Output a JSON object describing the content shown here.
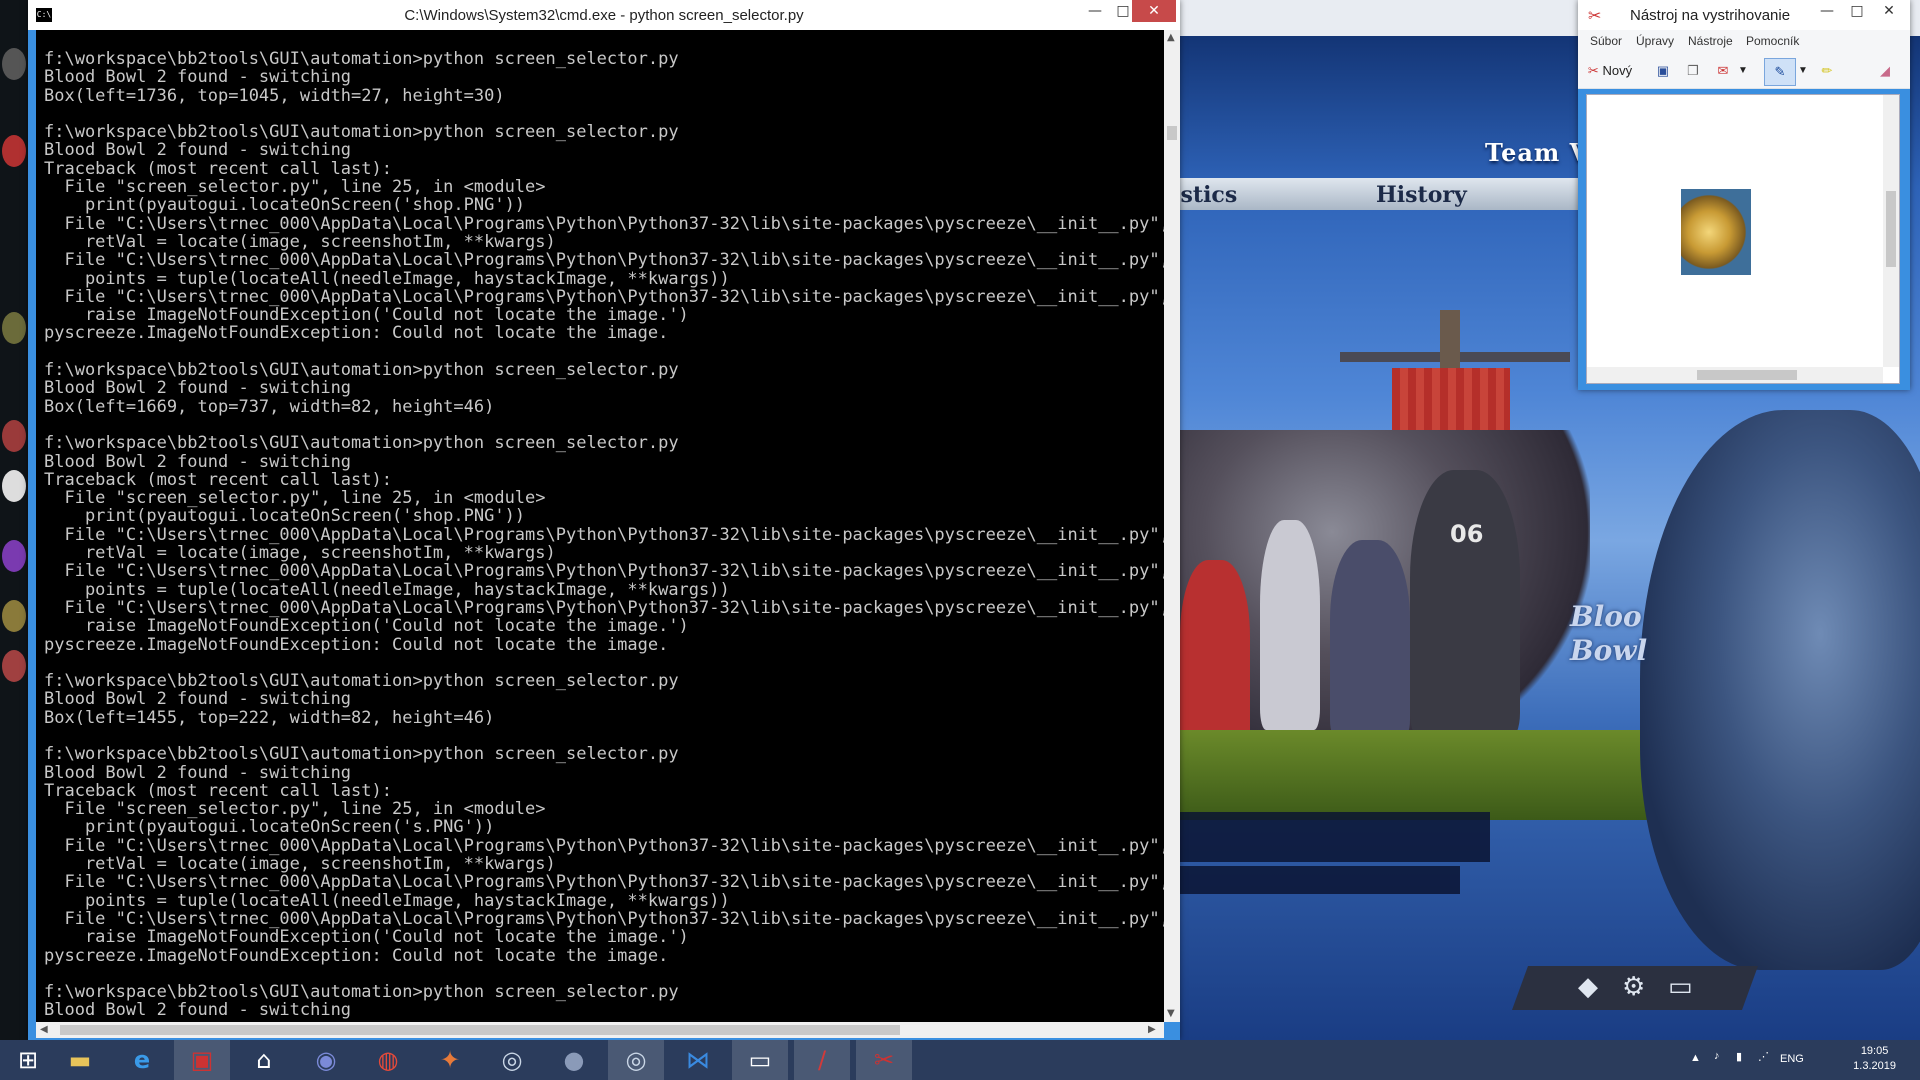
{
  "cmd_window": {
    "title": "C:\\Windows\\System32\\cmd.exe - python  screen_selector.py",
    "icon_text": "C:\\",
    "minimize": "—",
    "maximize": "□",
    "close": "✕",
    "console_lines": [
      "f:\\workspace\\bb2tools\\GUI\\automation>python screen_selector.py",
      "Blood Bowl 2 found - switching",
      "Box(left=1736, top=1045, width=27, height=30)",
      "",
      "f:\\workspace\\bb2tools\\GUI\\automation>python screen_selector.py",
      "Blood Bowl 2 found - switching",
      "Traceback (most recent call last):",
      "  File \"screen_selector.py\", line 25, in <module>",
      "    print(pyautogui.locateOnScreen('shop.PNG'))",
      "  File \"C:\\Users\\trnec_000\\AppData\\Local\\Programs\\Python\\Python37-32\\lib\\site-packages\\pyscreeze\\__init__.py\", l",
      "    retVal = locate(image, screenshotIm, **kwargs)",
      "  File \"C:\\Users\\trnec_000\\AppData\\Local\\Programs\\Python\\Python37-32\\lib\\site-packages\\pyscreeze\\__init__.py\", l",
      "    points = tuple(locateAll(needleImage, haystackImage, **kwargs))",
      "  File \"C:\\Users\\trnec_000\\AppData\\Local\\Programs\\Python\\Python37-32\\lib\\site-packages\\pyscreeze\\__init__.py\", l",
      "    raise ImageNotFoundException('Could not locate the image.')",
      "pyscreeze.ImageNotFoundException: Could not locate the image.",
      "",
      "f:\\workspace\\bb2tools\\GUI\\automation>python screen_selector.py",
      "Blood Bowl 2 found - switching",
      "Box(left=1669, top=737, width=82, height=46)",
      "",
      "f:\\workspace\\bb2tools\\GUI\\automation>python screen_selector.py",
      "Blood Bowl 2 found - switching",
      "Traceback (most recent call last):",
      "  File \"screen_selector.py\", line 25, in <module>",
      "    print(pyautogui.locateOnScreen('shop.PNG'))",
      "  File \"C:\\Users\\trnec_000\\AppData\\Local\\Programs\\Python\\Python37-32\\lib\\site-packages\\pyscreeze\\__init__.py\", l",
      "    retVal = locate(image, screenshotIm, **kwargs)",
      "  File \"C:\\Users\\trnec_000\\AppData\\Local\\Programs\\Python\\Python37-32\\lib\\site-packages\\pyscreeze\\__init__.py\", l",
      "    points = tuple(locateAll(needleImage, haystackImage, **kwargs))",
      "  File \"C:\\Users\\trnec_000\\AppData\\Local\\Programs\\Python\\Python37-32\\lib\\site-packages\\pyscreeze\\__init__.py\", l",
      "    raise ImageNotFoundException('Could not locate the image.')",
      "pyscreeze.ImageNotFoundException: Could not locate the image.",
      "",
      "f:\\workspace\\bb2tools\\GUI\\automation>python screen_selector.py",
      "Blood Bowl 2 found - switching",
      "Box(left=1455, top=222, width=82, height=46)",
      "",
      "f:\\workspace\\bb2tools\\GUI\\automation>python screen_selector.py",
      "Blood Bowl 2 found - switching",
      "Traceback (most recent call last):",
      "  File \"screen_selector.py\", line 25, in <module>",
      "    print(pyautogui.locateOnScreen('s.PNG'))",
      "  File \"C:\\Users\\trnec_000\\AppData\\Local\\Programs\\Python\\Python37-32\\lib\\site-packages\\pyscreeze\\__init__.py\", l",
      "    retVal = locate(image, screenshotIm, **kwargs)",
      "  File \"C:\\Users\\trnec_000\\AppData\\Local\\Programs\\Python\\Python37-32\\lib\\site-packages\\pyscreeze\\__init__.py\", l",
      "    points = tuple(locateAll(needleImage, haystackImage, **kwargs))",
      "  File \"C:\\Users\\trnec_000\\AppData\\Local\\Programs\\Python\\Python37-32\\lib\\site-packages\\pyscreeze\\__init__.py\", l",
      "    raise ImageNotFoundException('Could not locate the image.')",
      "pyscreeze.ImageNotFoundException: Could not locate the image.",
      "",
      "f:\\workspace\\bb2tools\\GUI\\automation>python screen_selector.py",
      "Blood Bowl 2 found - switching"
    ]
  },
  "game": {
    "team_title": "Team Val",
    "tabs": [
      "tistics",
      "History"
    ],
    "jersey_number": "06",
    "logo_lines": [
      "Bloo",
      "Bowl"
    ],
    "colors": {
      "sky": "#4f86d6",
      "banner": "#b52f2a",
      "grass": "#6b8a2a"
    }
  },
  "snipping_tool": {
    "title": "Nástroj na vystrihovanie",
    "menu": [
      "Súbor",
      "Úpravy",
      "Nástroje",
      "Pomocník"
    ],
    "new_label": "Nový",
    "controls": {
      "minimize": "—",
      "maximize": "□",
      "close": "✕"
    }
  },
  "taskbar": {
    "apps": [
      {
        "name": "start-button",
        "icon": "windows-logo"
      },
      {
        "name": "file-explorer",
        "icon": "folder"
      },
      {
        "name": "internet-explorer",
        "icon": "ie"
      },
      {
        "name": "floppy-app",
        "icon": "floppy"
      },
      {
        "name": "home-app",
        "icon": "house"
      },
      {
        "name": "discord",
        "icon": "discord"
      },
      {
        "name": "chrome",
        "icon": "chrome"
      },
      {
        "name": "blood-bowl-app",
        "icon": "game"
      },
      {
        "name": "steam",
        "icon": "steam"
      },
      {
        "name": "app-generic",
        "icon": "orb"
      },
      {
        "name": "steam-2",
        "icon": "steam"
      },
      {
        "name": "vscode",
        "icon": "vscode"
      },
      {
        "name": "cmd",
        "icon": "console"
      },
      {
        "name": "blood-bowl-2",
        "icon": "bb2"
      },
      {
        "name": "snipping-tool",
        "icon": "scissors"
      }
    ],
    "tray_lang": "ENG",
    "time": "19:05",
    "date": "1.3.2019"
  }
}
